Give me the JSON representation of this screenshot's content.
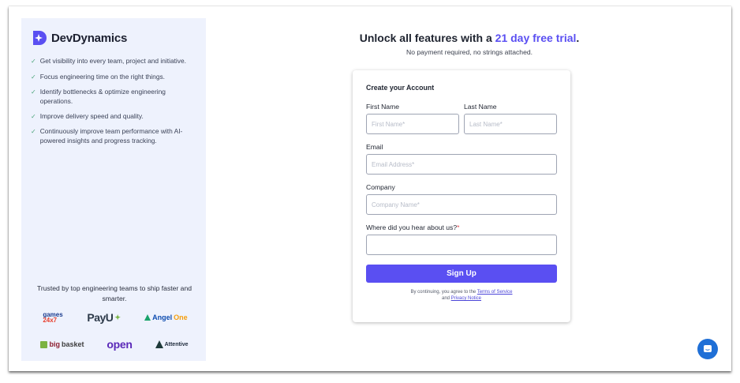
{
  "brand": {
    "name": "DevDynamics",
    "logo_icon": "sparkle-icon"
  },
  "features": [
    "Get visibility into every team, project and initiative.",
    "Focus engineering time on the right things.",
    "Identify bottlenecks & optimize engineering operations.",
    "Improve delivery speed and quality.",
    "Continuously improve team performance with AI-powered insights and progress tracking."
  ],
  "trusted_text": "Trusted by top engineering teams to ship faster and smarter.",
  "customer_logos": {
    "games": {
      "line1": "games",
      "line2": "24x7"
    },
    "payu": "PayU",
    "angel": {
      "part1": "Angel",
      "part2": "One"
    },
    "bigbasket": {
      "part1": "big",
      "part2": "basket"
    },
    "open": "open",
    "attentive": "Attentive"
  },
  "headline": {
    "prefix": "Unlock all features with a ",
    "highlight": "21 day free trial",
    "suffix": "."
  },
  "subline": "No payment required, no strings attached.",
  "form": {
    "title": "Create your Account",
    "first_name": {
      "label": "First Name",
      "placeholder": "First Name*",
      "value": ""
    },
    "last_name": {
      "label": "Last Name",
      "placeholder": "Last Name*",
      "value": ""
    },
    "email": {
      "label": "Email",
      "placeholder": "Email Address*",
      "value": ""
    },
    "company": {
      "label": "Company",
      "placeholder": "Company Name*",
      "value": ""
    },
    "source": {
      "label": "Where did you hear about us?",
      "required_mark": "*",
      "value": ""
    },
    "submit_label": "Sign Up",
    "legal": {
      "prefix": "By continuing, you agree to the ",
      "terms": "Terms of Service",
      "and": "and ",
      "privacy": "Privacy Notice"
    }
  },
  "colors": {
    "accent": "#5a4ff2",
    "panel_bg": "#eef2fd",
    "check": "#4ca57a",
    "chat": "#1f6fd6"
  },
  "chat_icon": "chat-bubble-icon"
}
